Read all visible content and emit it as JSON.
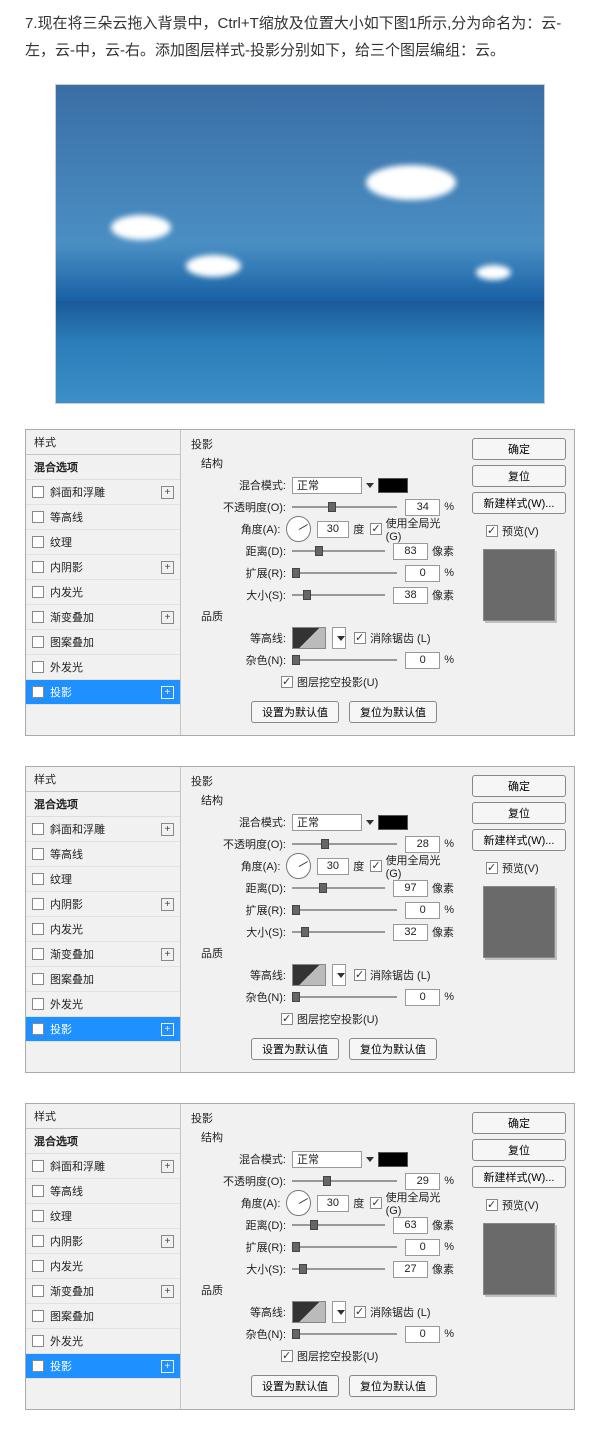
{
  "intro": "7.现在将三朵云拖入背景中，Ctrl+T缩放及位置大小如下图1所示,分为命名为：云-左，云-中，云-右。添加图层样式-投影分别如下，给三个图层编组：云。",
  "labels": {
    "styles": "样式",
    "blendOptions": "混合选项",
    "bevel": "斜面和浮雕",
    "contourItem": "等高线",
    "texture": "纹理",
    "innerShadow": "内阴影",
    "innerGlow": "内发光",
    "gradientOverlay": "渐变叠加",
    "patternOverlay": "图案叠加",
    "outerGlow": "外发光",
    "dropShadow": "投影",
    "structure": "结构",
    "blendMode": "混合模式:",
    "normal": "正常",
    "opacity": "不透明度(O):",
    "angle": "角度(A):",
    "degree": "度",
    "useGlobalLight": "使用全局光 (G)",
    "distance": "距离(D):",
    "spread": "扩展(R):",
    "size": "大小(S):",
    "pixels": "像素",
    "percent": "%",
    "quality": "品质",
    "contour": "等高线:",
    "antiAlias": "消除锯齿 (L)",
    "noise": "杂色(N):",
    "knockOut": "图层挖空投影(U)",
    "setDefault": "设置为默认值",
    "resetDefault": "复位为默认值",
    "ok": "确定",
    "reset": "复位",
    "newStyle": "新建样式(W)...",
    "preview": "预览(V)"
  },
  "panels": [
    {
      "opacity": "34",
      "angle": "30",
      "distance": "83",
      "spread": "0",
      "size": "38",
      "noise": "0"
    },
    {
      "opacity": "28",
      "angle": "30",
      "distance": "97",
      "spread": "0",
      "size": "32",
      "noise": "0"
    },
    {
      "opacity": "29",
      "angle": "30",
      "distance": "63",
      "spread": "0",
      "size": "27",
      "noise": "0"
    }
  ]
}
